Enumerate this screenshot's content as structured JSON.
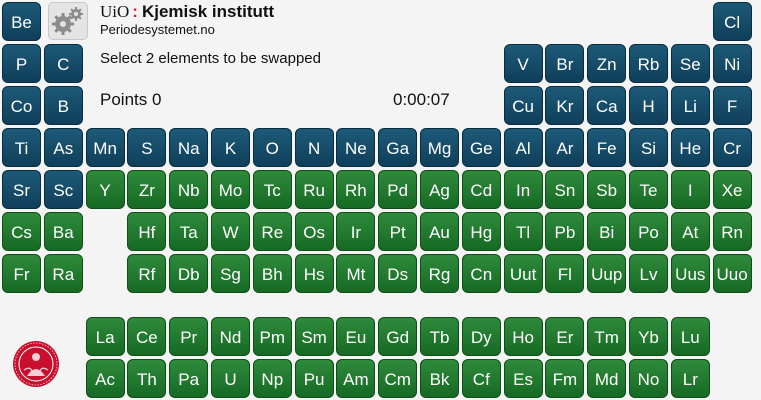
{
  "header": {
    "logo_mark": "UiO",
    "logo_dots": ":",
    "institute": "Kjemisk institutt",
    "site": "Periodesystemet.no"
  },
  "game": {
    "instruction": "Select 2 elements to be swapped",
    "points_label": "Points",
    "points": "0",
    "timer": "0:00:07"
  },
  "icons": {
    "settings": "gears-icon",
    "seal": "university-seal-icon"
  },
  "colors": {
    "blue_tile": "#0f3f5a",
    "green_tile": "#1c7a2b",
    "logo_dots": "#d21f1f"
  },
  "grid": [
    {
      "row": 1,
      "tiles": [
        {
          "col": 1,
          "symbol": "Be",
          "color": "blue"
        },
        {
          "col": 18,
          "symbol": "Cl",
          "color": "blue"
        }
      ]
    },
    {
      "row": 2,
      "tiles": [
        {
          "col": 1,
          "symbol": "P",
          "color": "blue"
        },
        {
          "col": 2,
          "symbol": "C",
          "color": "blue"
        },
        {
          "col": 13,
          "symbol": "V",
          "color": "blue"
        },
        {
          "col": 14,
          "symbol": "Br",
          "color": "blue"
        },
        {
          "col": 15,
          "symbol": "Zn",
          "color": "blue"
        },
        {
          "col": 16,
          "symbol": "Rb",
          "color": "blue"
        },
        {
          "col": 17,
          "symbol": "Se",
          "color": "blue"
        },
        {
          "col": 18,
          "symbol": "Ni",
          "color": "blue"
        }
      ]
    },
    {
      "row": 3,
      "tiles": [
        {
          "col": 1,
          "symbol": "Co",
          "color": "blue"
        },
        {
          "col": 2,
          "symbol": "B",
          "color": "blue"
        },
        {
          "col": 13,
          "symbol": "Cu",
          "color": "blue"
        },
        {
          "col": 14,
          "symbol": "Kr",
          "color": "blue"
        },
        {
          "col": 15,
          "symbol": "Ca",
          "color": "blue"
        },
        {
          "col": 16,
          "symbol": "H",
          "color": "blue"
        },
        {
          "col": 17,
          "symbol": "Li",
          "color": "blue"
        },
        {
          "col": 18,
          "symbol": "F",
          "color": "blue"
        }
      ]
    },
    {
      "row": 4,
      "tiles": [
        {
          "col": 1,
          "symbol": "Ti",
          "color": "blue"
        },
        {
          "col": 2,
          "symbol": "As",
          "color": "blue"
        },
        {
          "col": 3,
          "symbol": "Mn",
          "color": "blue"
        },
        {
          "col": 4,
          "symbol": "S",
          "color": "blue"
        },
        {
          "col": 5,
          "symbol": "Na",
          "color": "blue"
        },
        {
          "col": 6,
          "symbol": "K",
          "color": "blue"
        },
        {
          "col": 7,
          "symbol": "O",
          "color": "blue"
        },
        {
          "col": 8,
          "symbol": "N",
          "color": "blue"
        },
        {
          "col": 9,
          "symbol": "Ne",
          "color": "blue"
        },
        {
          "col": 10,
          "symbol": "Ga",
          "color": "blue"
        },
        {
          "col": 11,
          "symbol": "Mg",
          "color": "blue"
        },
        {
          "col": 12,
          "symbol": "Ge",
          "color": "blue"
        },
        {
          "col": 13,
          "symbol": "Al",
          "color": "blue"
        },
        {
          "col": 14,
          "symbol": "Ar",
          "color": "blue"
        },
        {
          "col": 15,
          "symbol": "Fe",
          "color": "blue"
        },
        {
          "col": 16,
          "symbol": "Si",
          "color": "blue"
        },
        {
          "col": 17,
          "symbol": "He",
          "color": "blue"
        },
        {
          "col": 18,
          "symbol": "Cr",
          "color": "blue"
        }
      ]
    },
    {
      "row": 5,
      "tiles": [
        {
          "col": 1,
          "symbol": "Sr",
          "color": "blue"
        },
        {
          "col": 2,
          "symbol": "Sc",
          "color": "blue"
        },
        {
          "col": 3,
          "symbol": "Y",
          "color": "green"
        },
        {
          "col": 4,
          "symbol": "Zr",
          "color": "green"
        },
        {
          "col": 5,
          "symbol": "Nb",
          "color": "green"
        },
        {
          "col": 6,
          "symbol": "Mo",
          "color": "green"
        },
        {
          "col": 7,
          "symbol": "Tc",
          "color": "green"
        },
        {
          "col": 8,
          "symbol": "Ru",
          "color": "green"
        },
        {
          "col": 9,
          "symbol": "Rh",
          "color": "green"
        },
        {
          "col": 10,
          "symbol": "Pd",
          "color": "green"
        },
        {
          "col": 11,
          "symbol": "Ag",
          "color": "green"
        },
        {
          "col": 12,
          "symbol": "Cd",
          "color": "green"
        },
        {
          "col": 13,
          "symbol": "In",
          "color": "green"
        },
        {
          "col": 14,
          "symbol": "Sn",
          "color": "green"
        },
        {
          "col": 15,
          "symbol": "Sb",
          "color": "green"
        },
        {
          "col": 16,
          "symbol": "Te",
          "color": "green"
        },
        {
          "col": 17,
          "symbol": "I",
          "color": "green"
        },
        {
          "col": 18,
          "symbol": "Xe",
          "color": "green"
        }
      ]
    },
    {
      "row": 6,
      "tiles": [
        {
          "col": 1,
          "symbol": "Cs",
          "color": "green"
        },
        {
          "col": 2,
          "symbol": "Ba",
          "color": "green"
        },
        {
          "col": 4,
          "symbol": "Hf",
          "color": "green"
        },
        {
          "col": 5,
          "symbol": "Ta",
          "color": "green"
        },
        {
          "col": 6,
          "symbol": "W",
          "color": "green"
        },
        {
          "col": 7,
          "symbol": "Re",
          "color": "green"
        },
        {
          "col": 8,
          "symbol": "Os",
          "color": "green"
        },
        {
          "col": 9,
          "symbol": "Ir",
          "color": "green"
        },
        {
          "col": 10,
          "symbol": "Pt",
          "color": "green"
        },
        {
          "col": 11,
          "symbol": "Au",
          "color": "green"
        },
        {
          "col": 12,
          "symbol": "Hg",
          "color": "green"
        },
        {
          "col": 13,
          "symbol": "Tl",
          "color": "green"
        },
        {
          "col": 14,
          "symbol": "Pb",
          "color": "green"
        },
        {
          "col": 15,
          "symbol": "Bi",
          "color": "green"
        },
        {
          "col": 16,
          "symbol": "Po",
          "color": "green"
        },
        {
          "col": 17,
          "symbol": "At",
          "color": "green"
        },
        {
          "col": 18,
          "symbol": "Rn",
          "color": "green"
        }
      ]
    },
    {
      "row": 7,
      "tiles": [
        {
          "col": 1,
          "symbol": "Fr",
          "color": "green"
        },
        {
          "col": 2,
          "symbol": "Ra",
          "color": "green"
        },
        {
          "col": 4,
          "symbol": "Rf",
          "color": "green"
        },
        {
          "col": 5,
          "symbol": "Db",
          "color": "green"
        },
        {
          "col": 6,
          "symbol": "Sg",
          "color": "green"
        },
        {
          "col": 7,
          "symbol": "Bh",
          "color": "green"
        },
        {
          "col": 8,
          "symbol": "Hs",
          "color": "green"
        },
        {
          "col": 9,
          "symbol": "Mt",
          "color": "green"
        },
        {
          "col": 10,
          "symbol": "Ds",
          "color": "green"
        },
        {
          "col": 11,
          "symbol": "Rg",
          "color": "green"
        },
        {
          "col": 12,
          "symbol": "Cn",
          "color": "green"
        },
        {
          "col": 13,
          "symbol": "Uut",
          "color": "green"
        },
        {
          "col": 14,
          "symbol": "Fl",
          "color": "green"
        },
        {
          "col": 15,
          "symbol": "Uup",
          "color": "green"
        },
        {
          "col": 16,
          "symbol": "Lv",
          "color": "green"
        },
        {
          "col": 17,
          "symbol": "Uus",
          "color": "green"
        },
        {
          "col": 18,
          "symbol": "Uuo",
          "color": "green"
        }
      ]
    },
    {
      "row": 8,
      "tiles": [
        {
          "col": 3,
          "symbol": "La",
          "color": "green"
        },
        {
          "col": 4,
          "symbol": "Ce",
          "color": "green"
        },
        {
          "col": 5,
          "symbol": "Pr",
          "color": "green"
        },
        {
          "col": 6,
          "symbol": "Nd",
          "color": "green"
        },
        {
          "col": 7,
          "symbol": "Pm",
          "color": "green"
        },
        {
          "col": 8,
          "symbol": "Sm",
          "color": "green"
        },
        {
          "col": 9,
          "symbol": "Eu",
          "color": "green"
        },
        {
          "col": 10,
          "symbol": "Gd",
          "color": "green"
        },
        {
          "col": 11,
          "symbol": "Tb",
          "color": "green"
        },
        {
          "col": 12,
          "symbol": "Dy",
          "color": "green"
        },
        {
          "col": 13,
          "symbol": "Ho",
          "color": "green"
        },
        {
          "col": 14,
          "symbol": "Er",
          "color": "green"
        },
        {
          "col": 15,
          "symbol": "Tm",
          "color": "green"
        },
        {
          "col": 16,
          "symbol": "Yb",
          "color": "green"
        },
        {
          "col": 17,
          "symbol": "Lu",
          "color": "green"
        }
      ]
    },
    {
      "row": 9,
      "tiles": [
        {
          "col": 3,
          "symbol": "Ac",
          "color": "green"
        },
        {
          "col": 4,
          "symbol": "Th",
          "color": "green"
        },
        {
          "col": 5,
          "symbol": "Pa",
          "color": "green"
        },
        {
          "col": 6,
          "symbol": "U",
          "color": "green"
        },
        {
          "col": 7,
          "symbol": "Np",
          "color": "green"
        },
        {
          "col": 8,
          "symbol": "Pu",
          "color": "green"
        },
        {
          "col": 9,
          "symbol": "Am",
          "color": "green"
        },
        {
          "col": 10,
          "symbol": "Cm",
          "color": "green"
        },
        {
          "col": 11,
          "symbol": "Bk",
          "color": "green"
        },
        {
          "col": 12,
          "symbol": "Cf",
          "color": "green"
        },
        {
          "col": 13,
          "symbol": "Es",
          "color": "green"
        },
        {
          "col": 14,
          "symbol": "Fm",
          "color": "green"
        },
        {
          "col": 15,
          "symbol": "Md",
          "color": "green"
        },
        {
          "col": 16,
          "symbol": "No",
          "color": "green"
        },
        {
          "col": 17,
          "symbol": "Lr",
          "color": "green"
        }
      ]
    }
  ]
}
